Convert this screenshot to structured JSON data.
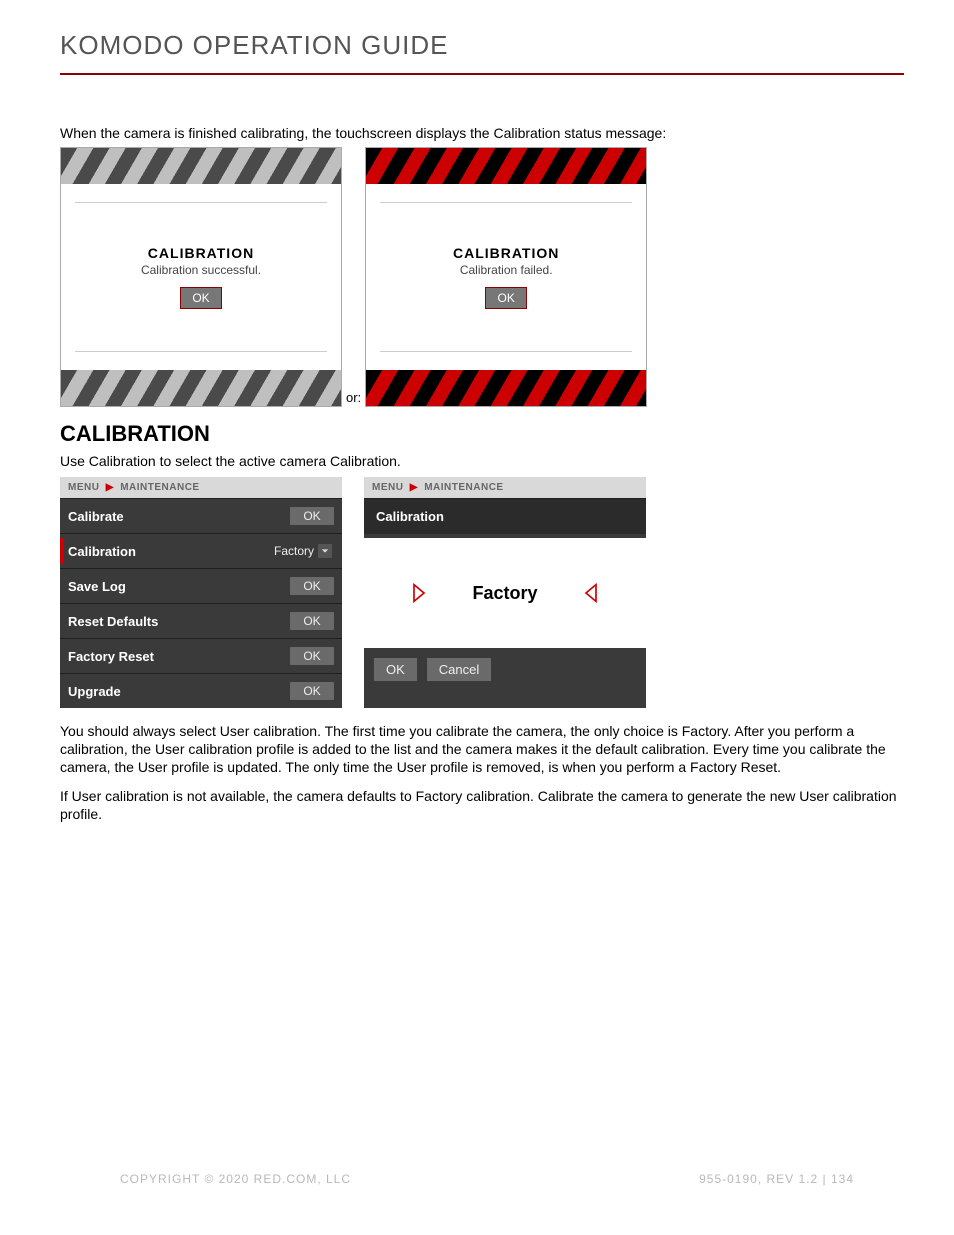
{
  "page": {
    "title": "KOMODO OPERATION GUIDE",
    "intro": "When the camera is finished calibrating, the touchscreen displays the Calibration status message:",
    "or_label": "or:"
  },
  "status_success": {
    "title": "CALIBRATION",
    "message": "Calibration successful.",
    "button": "OK"
  },
  "status_fail": {
    "title": "CALIBRATION",
    "message": "Calibration failed.",
    "button": "OK"
  },
  "section": {
    "heading": "CALIBRATION",
    "sub": "Use Calibration to select the active camera Calibration."
  },
  "breadcrumb": {
    "root": "MENU",
    "leaf": "MAINTENANCE"
  },
  "maintenance_menu": {
    "items": [
      {
        "label": "Calibrate",
        "value": "OK",
        "type": "ok"
      },
      {
        "label": "Calibration",
        "value": "Factory",
        "type": "dropdown",
        "selected": true
      },
      {
        "label": "Save Log",
        "value": "OK",
        "type": "ok"
      },
      {
        "label": "Reset Defaults",
        "value": "OK",
        "type": "ok"
      },
      {
        "label": "Factory Reset",
        "value": "OK",
        "type": "ok"
      },
      {
        "label": "Upgrade",
        "value": "OK",
        "type": "ok"
      }
    ]
  },
  "calibration_picker": {
    "title": "Calibration",
    "current": "Factory",
    "ok": "OK",
    "cancel": "Cancel"
  },
  "body": {
    "p1": "You should always select User calibration. The first time you calibrate the camera, the only choice is Factory. After you perform a calibration, the User calibration profile is added to the list and the camera makes it the default calibration. Every time you calibrate the camera, the User profile is updated. The only time the User profile is removed, is when you perform a Factory Reset.",
    "p2": "If User calibration is not available, the camera defaults to Factory calibration. Calibrate the camera to generate the new User calibration profile."
  },
  "footer": {
    "left": "COPYRIGHT © 2020 RED.COM, LLC",
    "right": "955-0190, REV 1.2  |  134"
  }
}
